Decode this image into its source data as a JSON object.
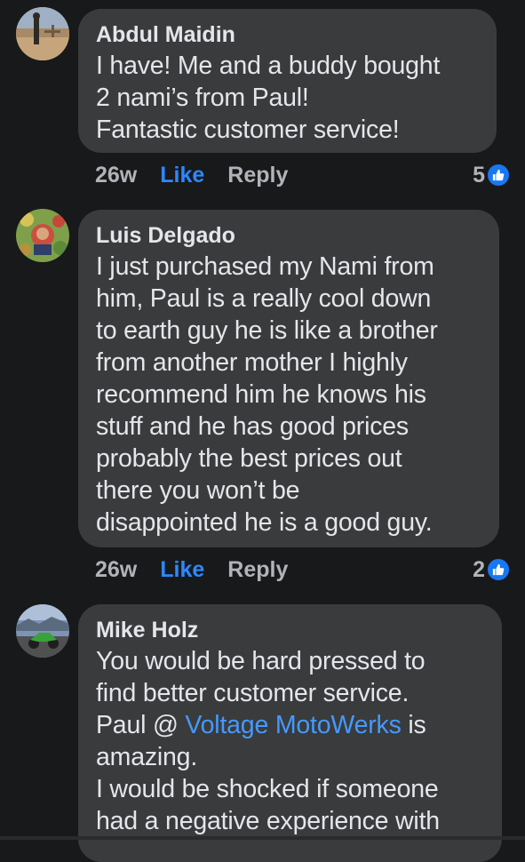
{
  "comments": [
    {
      "author": "Abdul Maidin",
      "lines": [
        "I have! Me and a buddy bought",
        "2 nami’s from Paul!",
        "Fantastic customer service!"
      ],
      "time": "26w",
      "like_label": "Like",
      "reply_label": "Reply",
      "reaction_count": "5",
      "reaction_icon": "thumbs-up-icon",
      "avatar_icon": "avatar-photo"
    },
    {
      "author": "Luis Delgado",
      "lines": [
        "I just purchased my Nami from",
        "him, Paul is a really cool down",
        "to earth guy he is like a brother",
        "from another mother I highly",
        "recommend him he knows his",
        "stuff and he has good prices",
        "probably the best prices out",
        "there you won’t be",
        "disappointed he is a good guy."
      ],
      "time": "26w",
      "like_label": "Like",
      "reply_label": "Reply",
      "reaction_count": "2",
      "reaction_icon": "thumbs-up-icon",
      "avatar_icon": "avatar-photo"
    },
    {
      "author": "Mike Holz",
      "lines_part1": [
        "You would be hard pressed to",
        "find better customer service."
      ],
      "line_with_link": {
        "before": "Paul @ ",
        "link": "Voltage MotoWerks",
        "after": " is"
      },
      "lines_part2": [
        "amazing.",
        "I would be shocked if someone",
        "had a negative experience with"
      ],
      "avatar_icon": "avatar-photo"
    }
  ],
  "colors": {
    "background": "#18191a",
    "bubble": "#3a3b3c",
    "text": "#e4e6eb",
    "secondary": "#b0b3b8",
    "like_blue": "#2d88ff",
    "link_blue": "#4599ff",
    "badge_blue": "#1877f2"
  }
}
